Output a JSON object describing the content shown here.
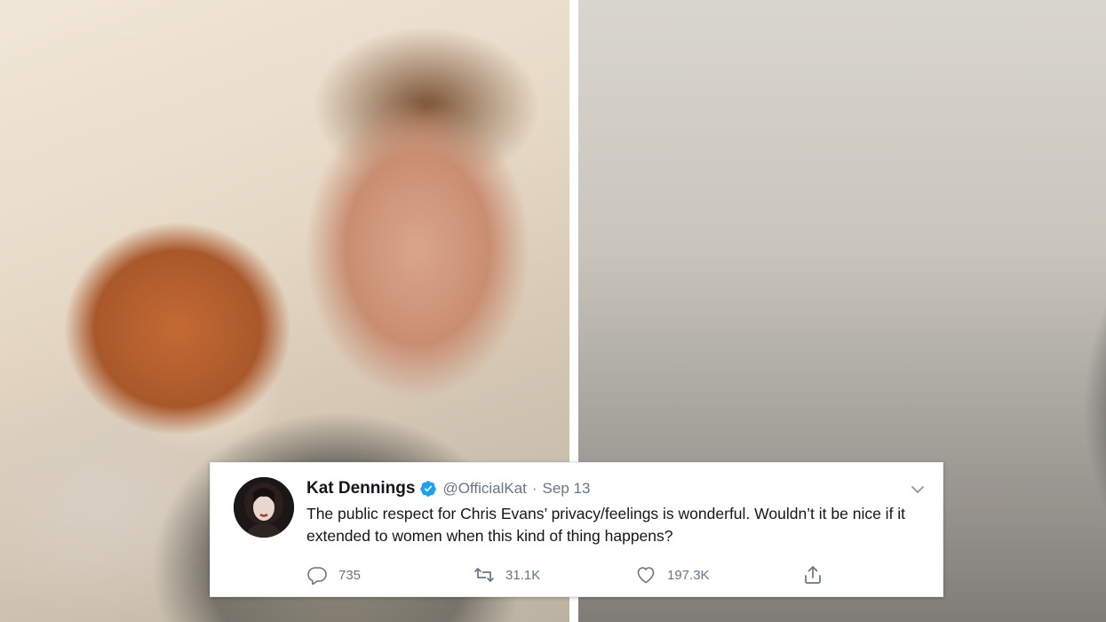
{
  "photos": {
    "left_icon": "photo-man-with-dog",
    "right_icon": "photo-man-hugging-dog"
  },
  "tweet": {
    "display_name": "Kat Dennings",
    "verified_icon": "verified-badge-icon",
    "handle": "@OfficialKat",
    "separator": "·",
    "date": "Sep 13",
    "text": "The public respect for Chris Evans’ privacy/feelings is wonderful. Wouldn’t it be nice if it extended to women when this kind of thing happens?",
    "actions": {
      "replies": "735",
      "retweets": "31.1K",
      "likes": "197.3K"
    }
  },
  "colors": {
    "text_primary": "#14171a",
    "text_secondary": "#657786",
    "verified_blue": "#1da1f2"
  }
}
